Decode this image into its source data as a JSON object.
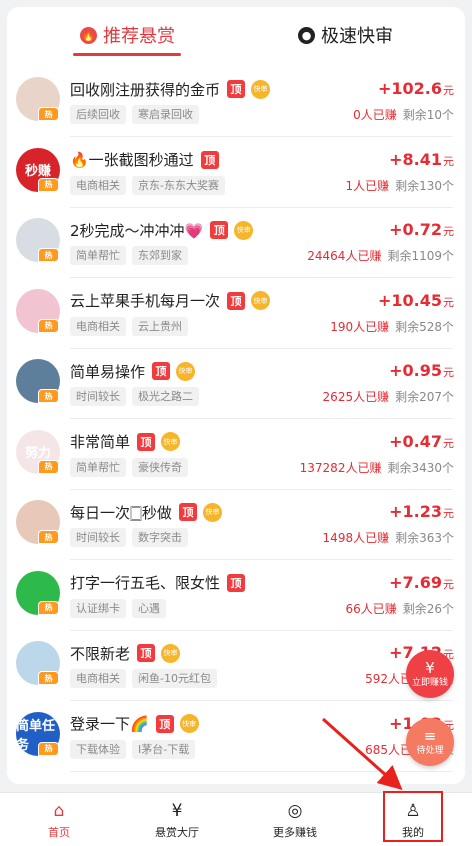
{
  "tabs": [
    {
      "label": "推荐悬赏",
      "icon": "flame-icon",
      "active": true
    },
    {
      "label": "极速快审",
      "icon": "user-badge-icon",
      "active": false
    }
  ],
  "badges": {
    "pin": "顶",
    "fast": "快审",
    "hot": "热"
  },
  "tasks": [
    {
      "title": "回收刚注册获得的金币",
      "tags": [
        "后续回收",
        "寒启录回收"
      ],
      "reward": "+102.6",
      "unit": "元",
      "earned": "0人已赚",
      "remain": "剩余10个",
      "fast": true,
      "avatar_text": "",
      "avatar_color": "#e9d4c9"
    },
    {
      "title": "🔥一张截图秒通过",
      "tags": [
        "电商相关",
        "京东-东东大奖赛"
      ],
      "reward": "+8.41",
      "unit": "元",
      "earned": "1人已赚",
      "remain": "剩余130个",
      "fast": false,
      "avatar_text": "秒赚",
      "avatar_color": "#d9232a"
    },
    {
      "title": "2秒完成～冲冲冲💗",
      "tags": [
        "简单帮忙",
        "东郊到家"
      ],
      "reward": "+0.72",
      "unit": "元",
      "earned": "24464人已赚",
      "remain": "剩余1109个",
      "fast": true,
      "avatar_text": "",
      "avatar_color": "#d8dde3"
    },
    {
      "title": "云上苹果手机每月一次",
      "tags": [
        "电商相关",
        "云上贵州"
      ],
      "reward": "+10.45",
      "unit": "元",
      "earned": "190人已赚",
      "remain": "剩余528个",
      "fast": true,
      "avatar_text": "",
      "avatar_color": "#f2c3d0"
    },
    {
      "title": "简单易操作",
      "tags": [
        "时间较长",
        "极光之路二"
      ],
      "reward": "+0.95",
      "unit": "元",
      "earned": "2625人已赚",
      "remain": "剩余207个",
      "fast": true,
      "avatar_text": "",
      "avatar_color": "#5d7f9c"
    },
    {
      "title": "非常简单",
      "tags": [
        "简单帮忙",
        "豪侠传奇"
      ],
      "reward": "+0.47",
      "unit": "元",
      "earned": "137282人已赚",
      "remain": "剩余3430个",
      "fast": true,
      "avatar_text": "努力",
      "avatar_color": "#f4e6e6"
    },
    {
      "title": "每日一次🀆秒做",
      "tags": [
        "时间较长",
        "数字突击"
      ],
      "reward": "+1.23",
      "unit": "元",
      "earned": "1498人已赚",
      "remain": "剩余363个",
      "fast": true,
      "avatar_text": "",
      "avatar_color": "#e8c8b8"
    },
    {
      "title": "打字一行五毛、限女性",
      "tags": [
        "认证绑卡",
        "心遇"
      ],
      "reward": "+7.69",
      "unit": "元",
      "earned": "66人已赚",
      "remain": "剩余26个",
      "fast": false,
      "avatar_text": "",
      "avatar_color": "#2dba4a"
    },
    {
      "title": "不限新老",
      "tags": [
        "电商相关",
        "闲鱼-10元红包"
      ],
      "reward": "+7.12",
      "unit": "元",
      "earned": "592人已赚",
      "remain": "剩余",
      "fast": true,
      "avatar_text": "",
      "avatar_color": "#bcd7ea"
    },
    {
      "title": "登录一下🌈",
      "tags": [
        "下载体验",
        "I茅台-下载"
      ],
      "reward": "+1.02",
      "unit": "元",
      "earned": "685人已赚",
      "remain": "剩余",
      "fast": true,
      "avatar_text": "简单任务",
      "avatar_color": "#1f5fc6"
    }
  ],
  "fabs": {
    "earn": {
      "glyph": "¥",
      "label": "立即赚钱"
    },
    "pending": {
      "glyph": "≡",
      "label": "待处理"
    }
  },
  "bottom_nav": [
    {
      "label": "首页",
      "icon": "home-icon",
      "glyph": "⌂",
      "active": true
    },
    {
      "label": "悬赏大厅",
      "icon": "yuan-tag-icon",
      "glyph": "¥",
      "active": false
    },
    {
      "label": "更多赚钱",
      "icon": "gamepad-icon",
      "glyph": "◎",
      "active": false
    },
    {
      "label": "我的",
      "icon": "person-icon",
      "glyph": "♙",
      "active": false
    }
  ]
}
